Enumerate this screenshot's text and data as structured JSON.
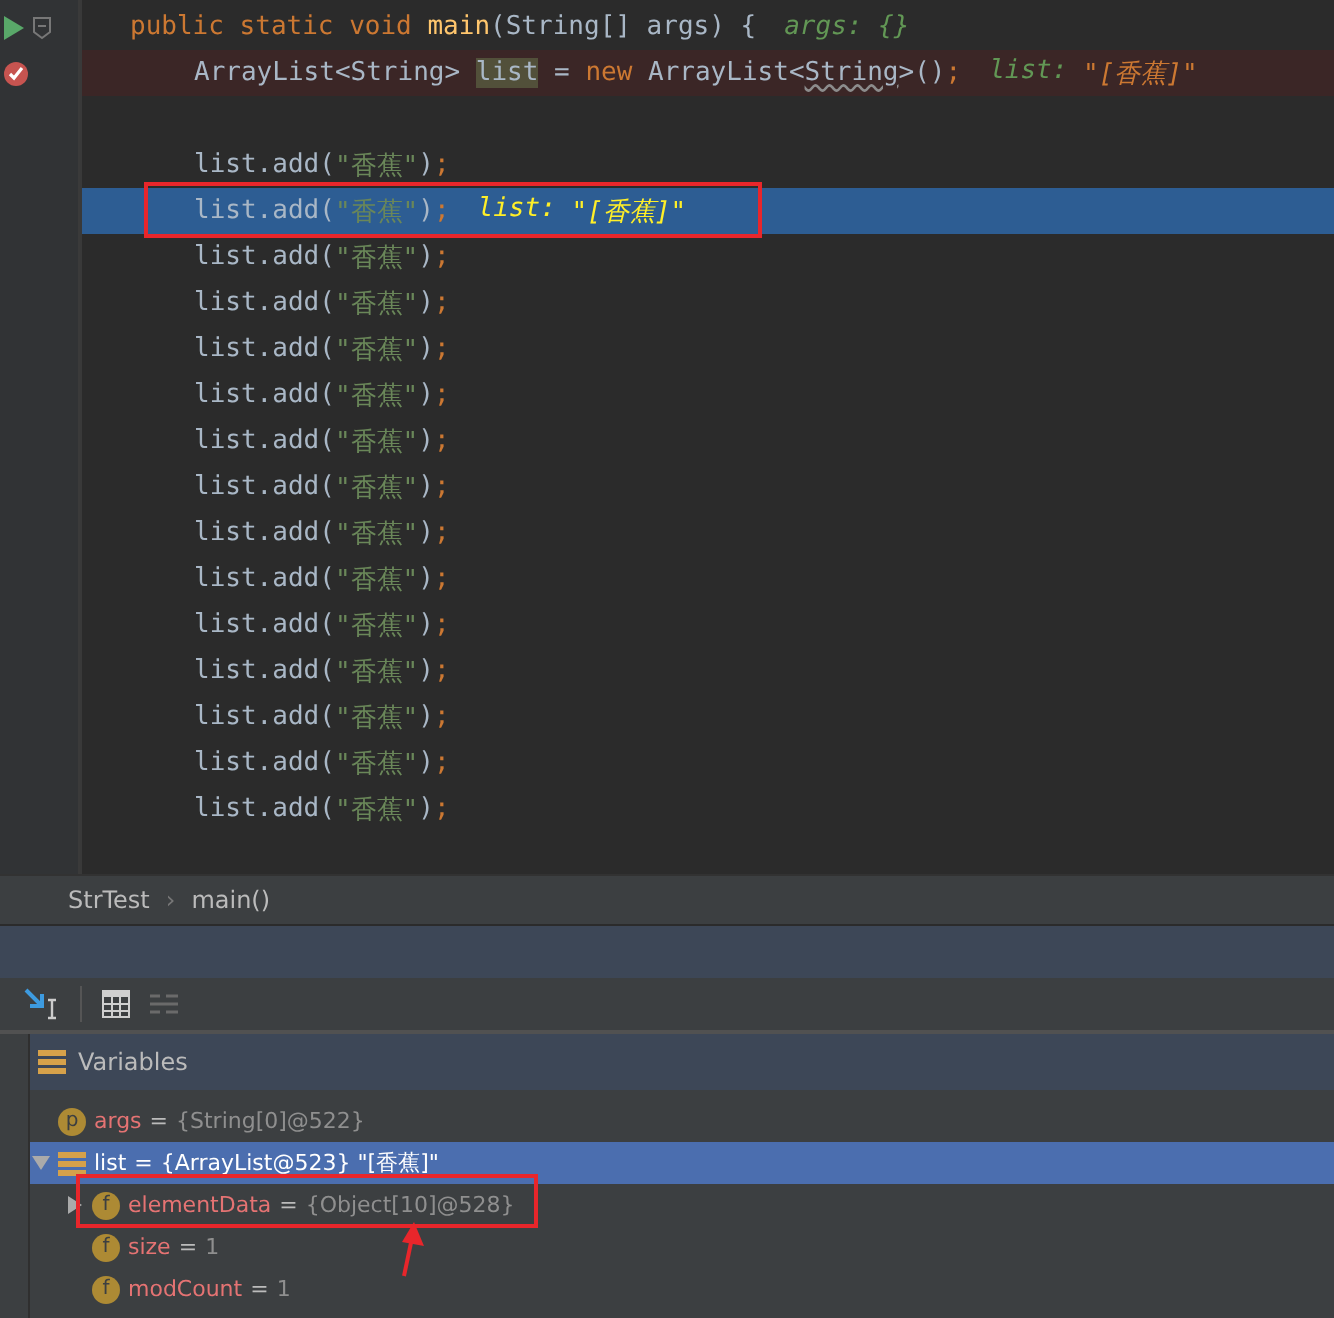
{
  "editor": {
    "lines": [
      {
        "kind": "signature",
        "breakpoint": false,
        "current": false,
        "tokens": [
          {
            "kind": "kw",
            "t": "public static void "
          },
          {
            "kind": "method",
            "t": "main"
          },
          {
            "kind": "plain",
            "t": "(String[] args) {"
          }
        ],
        "hint": [
          {
            "kind": "hint-label",
            "t": "args: {}"
          }
        ]
      },
      {
        "kind": "statement",
        "breakpoint": true,
        "current": false,
        "tokens": [
          {
            "kind": "plain",
            "t": "ArrayList<String> "
          },
          {
            "kind": "usage",
            "t": "list"
          },
          {
            "kind": "plain",
            "t": " = "
          },
          {
            "kind": "kw",
            "t": "new "
          },
          {
            "kind": "plain",
            "t": "ArrayList<"
          },
          {
            "kind": "warn",
            "t": "String"
          },
          {
            "kind": "plain",
            "t": ">()"
          },
          {
            "kind": "kw",
            "t": ";"
          }
        ],
        "hint": [
          {
            "kind": "hint-label",
            "t": "list: "
          },
          {
            "kind": "hint-value",
            "t": "\"[香蕉]\""
          }
        ]
      },
      {
        "kind": "blank"
      },
      {
        "kind": "statement",
        "breakpoint": false,
        "current": false,
        "tokens": [
          {
            "kind": "plain",
            "t": "list.add("
          },
          {
            "kind": "str",
            "t": "\"香蕉\""
          },
          {
            "kind": "plain",
            "t": ")"
          },
          {
            "kind": "kw",
            "t": ";"
          }
        ]
      },
      {
        "kind": "statement",
        "breakpoint": false,
        "current": true,
        "tokens": [
          {
            "kind": "plain",
            "t": "list.add("
          },
          {
            "kind": "str",
            "t": "\"香蕉\""
          },
          {
            "kind": "plain",
            "t": ")"
          },
          {
            "kind": "kw",
            "t": ";"
          }
        ],
        "hint": [
          {
            "kind": "hint-label",
            "t": "list: "
          },
          {
            "kind": "hint-value",
            "t": "\"[香蕉]\""
          }
        ]
      },
      {
        "kind": "statement",
        "breakpoint": false,
        "current": false,
        "tokens": [
          {
            "kind": "plain",
            "t": "list.add("
          },
          {
            "kind": "str",
            "t": "\"香蕉\""
          },
          {
            "kind": "plain",
            "t": ")"
          },
          {
            "kind": "kw",
            "t": ";"
          }
        ]
      },
      {
        "kind": "statement",
        "breakpoint": false,
        "current": false,
        "tokens": [
          {
            "kind": "plain",
            "t": "list.add("
          },
          {
            "kind": "str",
            "t": "\"香蕉\""
          },
          {
            "kind": "plain",
            "t": ")"
          },
          {
            "kind": "kw",
            "t": ";"
          }
        ]
      },
      {
        "kind": "statement",
        "breakpoint": false,
        "current": false,
        "tokens": [
          {
            "kind": "plain",
            "t": "list.add("
          },
          {
            "kind": "str",
            "t": "\"香蕉\""
          },
          {
            "kind": "plain",
            "t": ")"
          },
          {
            "kind": "kw",
            "t": ";"
          }
        ]
      },
      {
        "kind": "statement",
        "breakpoint": false,
        "current": false,
        "tokens": [
          {
            "kind": "plain",
            "t": "list.add("
          },
          {
            "kind": "str",
            "t": "\"香蕉\""
          },
          {
            "kind": "plain",
            "t": ")"
          },
          {
            "kind": "kw",
            "t": ";"
          }
        ]
      },
      {
        "kind": "statement",
        "breakpoint": false,
        "current": false,
        "tokens": [
          {
            "kind": "plain",
            "t": "list.add("
          },
          {
            "kind": "str",
            "t": "\"香蕉\""
          },
          {
            "kind": "plain",
            "t": ")"
          },
          {
            "kind": "kw",
            "t": ";"
          }
        ]
      },
      {
        "kind": "statement",
        "breakpoint": false,
        "current": false,
        "tokens": [
          {
            "kind": "plain",
            "t": "list.add("
          },
          {
            "kind": "str",
            "t": "\"香蕉\""
          },
          {
            "kind": "plain",
            "t": ")"
          },
          {
            "kind": "kw",
            "t": ";"
          }
        ]
      },
      {
        "kind": "statement",
        "breakpoint": false,
        "current": false,
        "tokens": [
          {
            "kind": "plain",
            "t": "list.add("
          },
          {
            "kind": "str",
            "t": "\"香蕉\""
          },
          {
            "kind": "plain",
            "t": ")"
          },
          {
            "kind": "kw",
            "t": ";"
          }
        ]
      },
      {
        "kind": "statement",
        "breakpoint": false,
        "current": false,
        "tokens": [
          {
            "kind": "plain",
            "t": "list.add("
          },
          {
            "kind": "str",
            "t": "\"香蕉\""
          },
          {
            "kind": "plain",
            "t": ")"
          },
          {
            "kind": "kw",
            "t": ";"
          }
        ]
      },
      {
        "kind": "statement",
        "breakpoint": false,
        "current": false,
        "tokens": [
          {
            "kind": "plain",
            "t": "list.add("
          },
          {
            "kind": "str",
            "t": "\"香蕉\""
          },
          {
            "kind": "plain",
            "t": ")"
          },
          {
            "kind": "kw",
            "t": ";"
          }
        ]
      },
      {
        "kind": "statement",
        "breakpoint": false,
        "current": false,
        "tokens": [
          {
            "kind": "plain",
            "t": "list.add("
          },
          {
            "kind": "str",
            "t": "\"香蕉\""
          },
          {
            "kind": "plain",
            "t": ")"
          },
          {
            "kind": "kw",
            "t": ";"
          }
        ]
      },
      {
        "kind": "statement",
        "breakpoint": false,
        "current": false,
        "tokens": [
          {
            "kind": "plain",
            "t": "list.add("
          },
          {
            "kind": "str",
            "t": "\"香蕉\""
          },
          {
            "kind": "plain",
            "t": ")"
          },
          {
            "kind": "kw",
            "t": ";"
          }
        ]
      },
      {
        "kind": "statement",
        "breakpoint": false,
        "current": false,
        "tokens": [
          {
            "kind": "plain",
            "t": "list.add("
          },
          {
            "kind": "str",
            "t": "\"香蕉\""
          },
          {
            "kind": "plain",
            "t": ")"
          },
          {
            "kind": "kw",
            "t": ";"
          }
        ]
      },
      {
        "kind": "statement",
        "breakpoint": false,
        "current": false,
        "tokens": [
          {
            "kind": "plain",
            "t": "list.add("
          },
          {
            "kind": "str",
            "t": "\"香蕉\""
          },
          {
            "kind": "plain",
            "t": ")"
          },
          {
            "kind": "kw",
            "t": ";"
          }
        ]
      },
      {
        "kind": "blank"
      }
    ]
  },
  "breadcrumbs": {
    "items": [
      "StrTest",
      "main()"
    ],
    "separator": "›"
  },
  "variables": {
    "title": "Variables",
    "items": [
      {
        "badge": "p",
        "name": "args",
        "operator": "=",
        "value": "{String[0]@522}",
        "selected": false
      },
      {
        "name": "list",
        "operator": "=",
        "value": "{ArrayList@523} \"[香蕉]\"",
        "selected": true,
        "expanded": true,
        "children": [
          {
            "badge": "f",
            "name": "elementData",
            "operator": "=",
            "value": "{Object[10]@528}",
            "selected": false,
            "expanded": false
          },
          {
            "badge": "f",
            "name": "size",
            "operator": "=",
            "value": "1",
            "selected": false
          },
          {
            "badge": "f",
            "name": "modCount",
            "operator": "=",
            "value": "1",
            "selected": false
          }
        ]
      }
    ]
  }
}
